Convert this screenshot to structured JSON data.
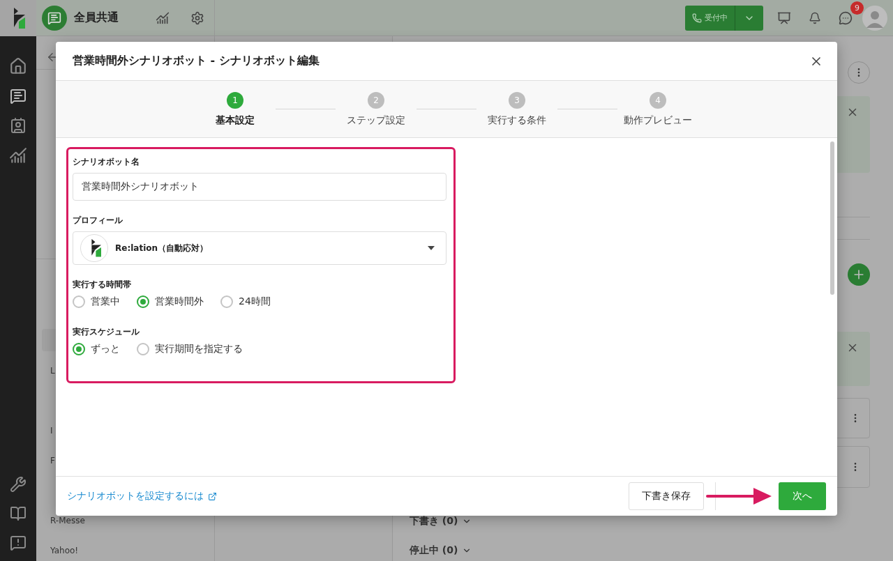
{
  "app_header": {
    "workspace": "全員共通",
    "status_button": "受付中",
    "notification_badge": "9"
  },
  "list_panel": {
    "items": [
      {
        "kind": "heading",
        "selected": false
      },
      {
        "kind": "item",
        "selected": false
      },
      {
        "kind": "item",
        "selected": false
      },
      {
        "kind": "item",
        "selected": false
      },
      {
        "kind": "item",
        "selected": false
      },
      {
        "kind": "item",
        "selected": false
      },
      {
        "kind": "heading",
        "selected": false
      },
      {
        "kind": "item",
        "selected": false
      },
      {
        "kind": "item",
        "selected": true
      },
      {
        "label": "L",
        "kind": "item",
        "selected": false
      },
      {
        "kind": "item",
        "selected": false
      },
      {
        "label": "I",
        "kind": "item",
        "selected": false
      },
      {
        "label": "F",
        "kind": "item",
        "selected": false
      },
      {
        "kind": "item",
        "selected": false
      },
      {
        "label": "R-Messe",
        "kind": "item",
        "selected": false
      },
      {
        "label": "Yahoo!",
        "kind": "item",
        "selected": false
      }
    ]
  },
  "main": {
    "sections": [
      {
        "label": "下書き (0)"
      },
      {
        "label": "停止中 (0)"
      }
    ]
  },
  "modal": {
    "title": "営業時間外シナリオボット - シナリオボット編集",
    "steps": [
      {
        "number": "1",
        "label": "基本設定",
        "selected": true
      },
      {
        "number": "2",
        "label": "ステップ設定",
        "selected": false
      },
      {
        "number": "3",
        "label": "実行する条件",
        "selected": false
      },
      {
        "number": "4",
        "label": "動作プレビュー",
        "selected": false
      }
    ],
    "name_field": {
      "label": "シナリオボット名",
      "value": "営業時間外シナリオボット"
    },
    "profile_field": {
      "label": "プロフィール",
      "value": "Re:lation（自動応対）"
    },
    "time_zone": {
      "label": "実行する時間帯",
      "options": [
        {
          "label": "営業中",
          "selected": false
        },
        {
          "label": "営業時間外",
          "selected": true
        },
        {
          "label": "24時間",
          "selected": false
        }
      ]
    },
    "schedule": {
      "label": "実行スケジュール",
      "options": [
        {
          "label": "ずっと",
          "selected": true
        },
        {
          "label": "実行期間を指定する",
          "selected": false
        }
      ]
    },
    "help_link": "シナリオボットを設定するには",
    "buttons": {
      "save_draft": "下書き保存",
      "next": "次へ"
    }
  }
}
